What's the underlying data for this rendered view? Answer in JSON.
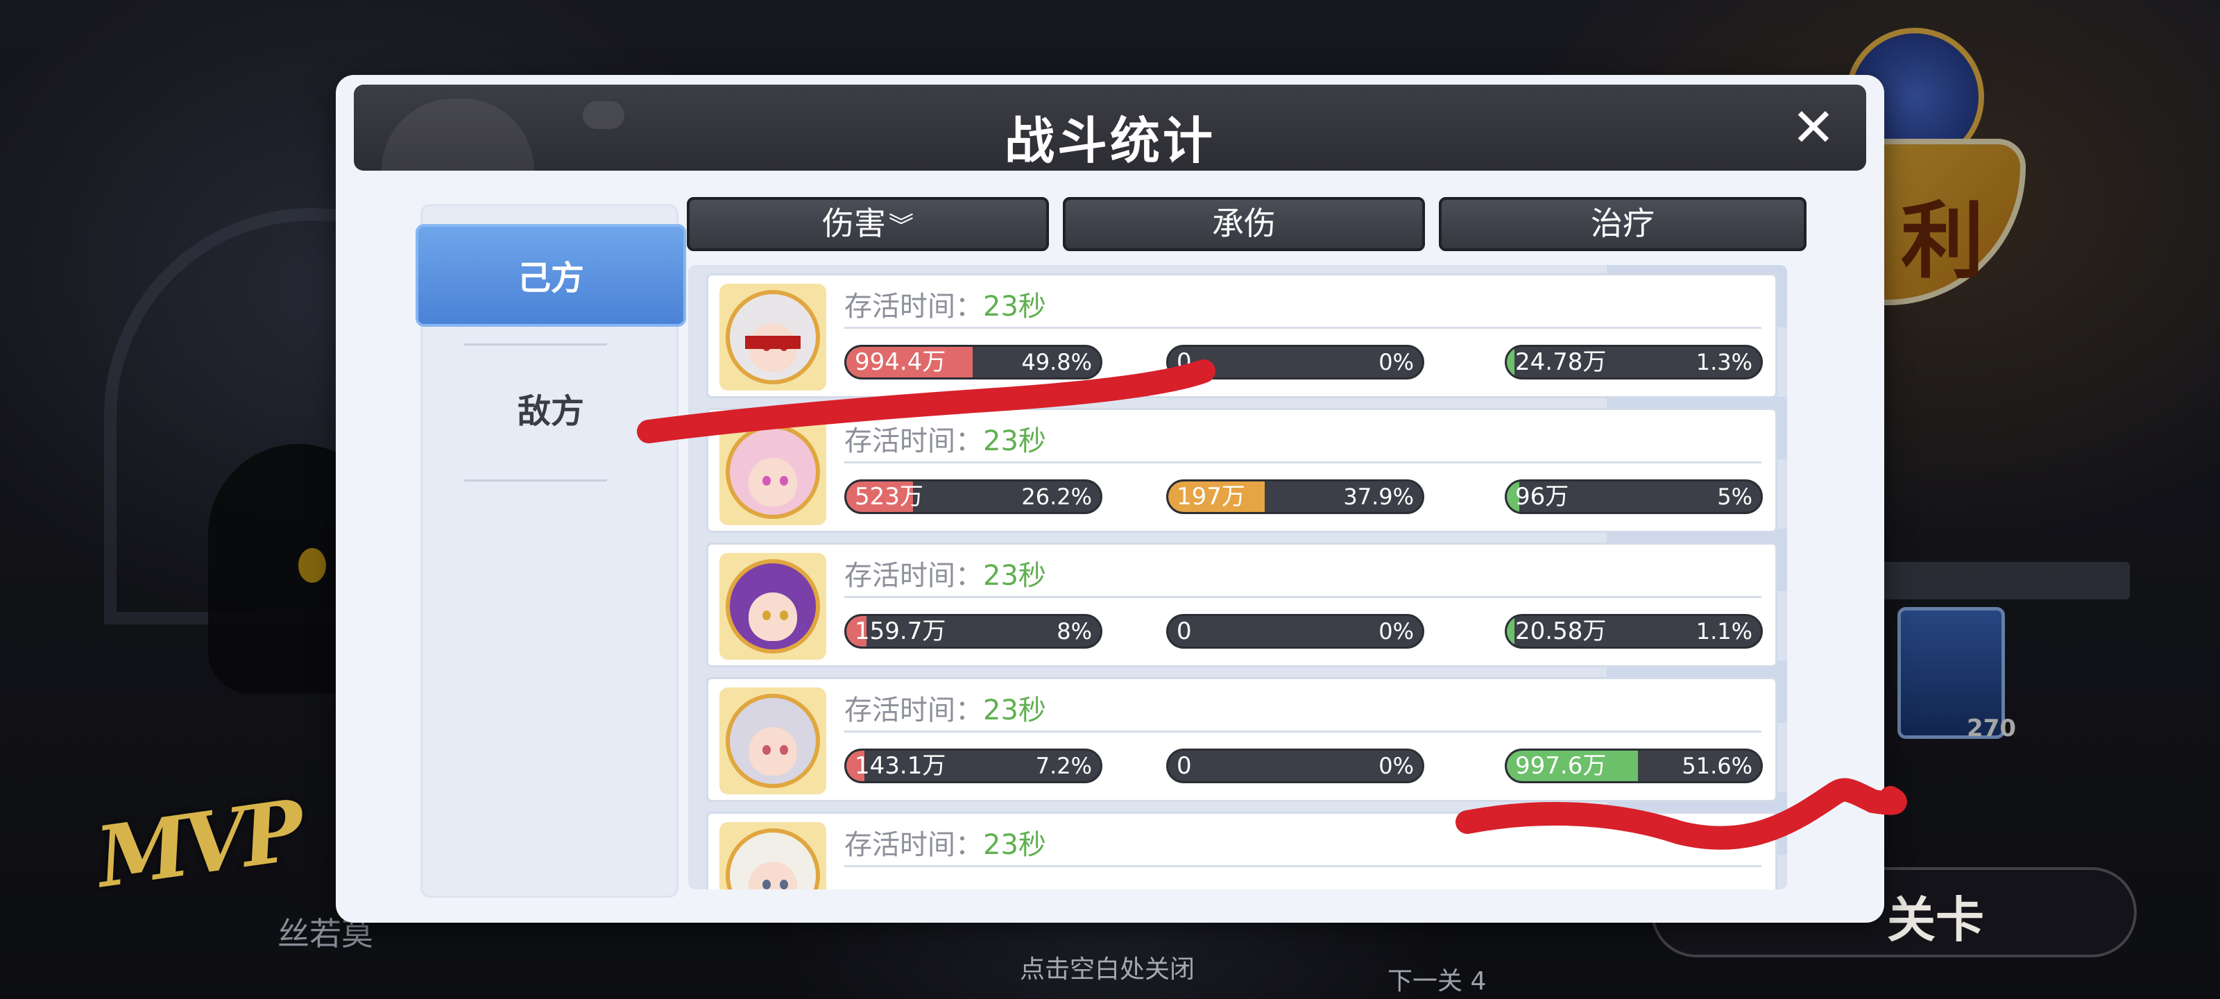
{
  "background": {
    "mvp_text": "MVP",
    "mvp_name": "丝若莫",
    "victory_glyph": "利",
    "stage_label": "关卡",
    "next_stage": "下一关 4",
    "card_level": "270",
    "close_hint": "点击空白处关闭"
  },
  "panel": {
    "title": "战斗统计",
    "close_icon": "✕",
    "side_tabs": [
      {
        "label": "己方",
        "active": true
      },
      {
        "label": "敌方",
        "active": false
      }
    ],
    "categories": [
      {
        "label": "伤害",
        "sort_icon": "double-chevron-down-icon",
        "active": true
      },
      {
        "label": "承伤",
        "active": false
      },
      {
        "label": "治疗",
        "active": false
      }
    ],
    "survival_label": "存活时间：",
    "rows": [
      {
        "portrait": "white-hair-blindfold-portrait",
        "survival_time": "23秒",
        "damage": {
          "value": "994.4万",
          "percent": "49.8%",
          "fill": 0.498
        },
        "taken": {
          "value": "0",
          "percent": "0%",
          "fill": 0
        },
        "heal": {
          "value": "24.78万",
          "percent": "1.3%",
          "fill": 0.013
        }
      },
      {
        "portrait": "pink-hair-portrait",
        "survival_time": "23秒",
        "damage": {
          "value": "523万",
          "percent": "26.2%",
          "fill": 0.262
        },
        "taken": {
          "value": "197万",
          "percent": "37.9%",
          "fill": 0.379
        },
        "heal": {
          "value": "96万",
          "percent": "5%",
          "fill": 0.05
        }
      },
      {
        "portrait": "purple-hair-portrait",
        "survival_time": "23秒",
        "damage": {
          "value": "159.7万",
          "percent": "8%",
          "fill": 0.08
        },
        "taken": {
          "value": "0",
          "percent": "0%",
          "fill": 0
        },
        "heal": {
          "value": "20.58万",
          "percent": "1.1%",
          "fill": 0.011
        }
      },
      {
        "portrait": "silver-hair-portrait",
        "survival_time": "23秒",
        "damage": {
          "value": "143.1万",
          "percent": "7.2%",
          "fill": 0.072
        },
        "taken": {
          "value": "0",
          "percent": "0%",
          "fill": 0
        },
        "heal": {
          "value": "997.6万",
          "percent": "51.6%",
          "fill": 0.516
        }
      },
      {
        "portrait": "white-hood-portrait",
        "survival_time": "23秒"
      }
    ]
  },
  "colors": {
    "damage_fill": "#e06a6a",
    "taken_fill": "#e6a444",
    "heal_fill": "#6cc06a",
    "marker_red": "#d8202a"
  }
}
